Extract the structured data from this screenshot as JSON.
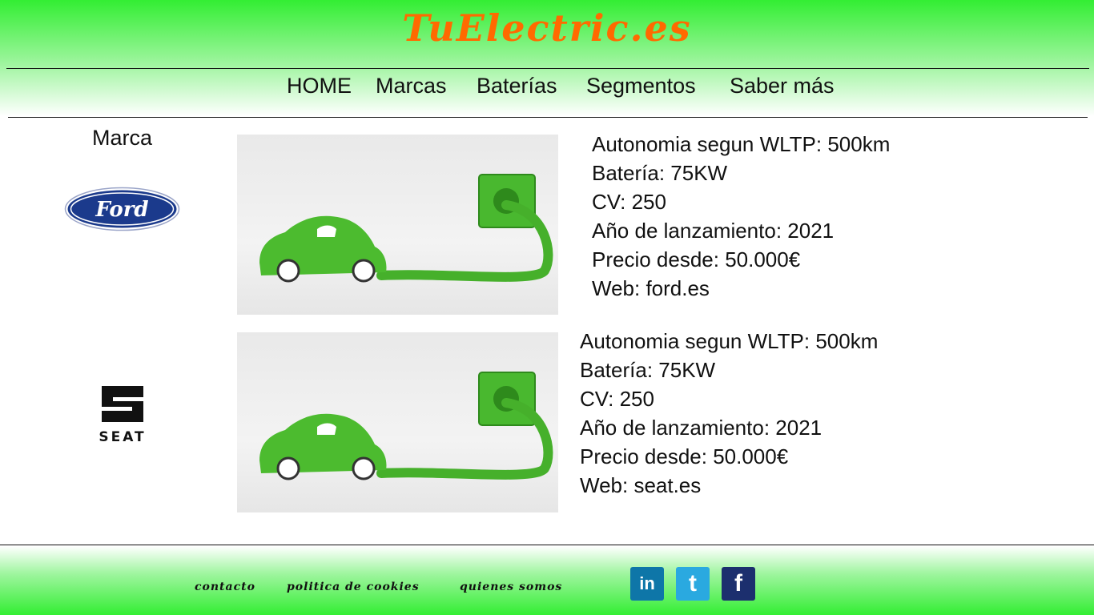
{
  "site": {
    "title": "TuElectric.es"
  },
  "nav": {
    "items": [
      "HOME",
      "Marcas",
      "Baterías",
      "Segmentos",
      "Saber más"
    ]
  },
  "main": {
    "column_label": "Marca",
    "cars": [
      {
        "brand": "ford-logo",
        "brand_text": "Ford",
        "image": "green-grass-electric-car-image",
        "specs": [
          "Autonomia segun WLTP: 500km",
          "Batería: 75KW",
          "CV: 250",
          "Año de lanzamiento: 2021",
          "Precio desde: 50.000€",
          "Web: ford.es"
        ]
      },
      {
        "brand": "seat-logo",
        "brand_text": "SEAT",
        "image": "green-grass-electric-car-image",
        "specs": [
          "Autonomia segun WLTP: 500km",
          "Batería: 75KW",
          "CV: 250",
          "Año de lanzamiento: 2021",
          "Precio desde: 50.000€",
          "Web: seat.es"
        ]
      }
    ]
  },
  "footer": {
    "links": [
      "contacto",
      "politica de cookies",
      "quienes somos"
    ],
    "social": [
      {
        "name": "linkedin-icon",
        "glyph": "in",
        "color": "#0e76a8"
      },
      {
        "name": "twitter-icon",
        "glyph": "t",
        "color": "#2aa9e0"
      },
      {
        "name": "facebook-icon",
        "glyph": "f",
        "color": "#1c2f6e"
      }
    ]
  },
  "colors": {
    "header_green": "#33ee33",
    "logo_orange": "#ff6a00",
    "grass_green": "#3fae2a"
  }
}
